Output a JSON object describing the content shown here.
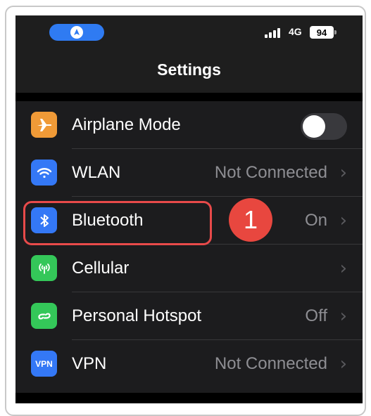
{
  "status_bar": {
    "nav_icon": "navigation-arrow-icon",
    "network": "4G",
    "battery": "94"
  },
  "header": {
    "title": "Settings"
  },
  "settings": {
    "rows": [
      {
        "label": "Airplane Mode",
        "icon": "airplane-icon",
        "icon_color": "#f09a37",
        "toggle_on": false
      },
      {
        "label": "WLAN",
        "icon": "wifi-icon",
        "icon_color": "#3478f6",
        "value": "Not Connected"
      },
      {
        "label": "Bluetooth",
        "icon": "bluetooth-icon",
        "icon_color": "#3478f6",
        "value": "On"
      },
      {
        "label": "Cellular",
        "icon": "cellular-antenna-icon",
        "icon_color": "#34c759",
        "value": ""
      },
      {
        "label": "Personal Hotspot",
        "icon": "hotspot-link-icon",
        "icon_color": "#34c759",
        "value": "Off"
      },
      {
        "label": "VPN",
        "icon": "vpn-icon",
        "icon_color": "#3478f6",
        "icon_text": "VPN",
        "value": "Not Connected"
      }
    ]
  },
  "annotation": {
    "step_number": "1",
    "highlight_color": "#e84a4a"
  }
}
